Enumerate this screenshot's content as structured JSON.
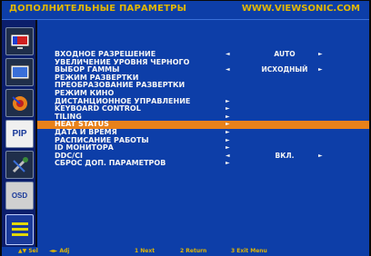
{
  "header": {
    "title": "ДОПОЛНИТЕЛЬНЫЕ ПАРАМЕТРЫ",
    "url": "WWW.VIEWSONIC.COM"
  },
  "sidebar": {
    "icons": [
      "monitor-icon",
      "screen-icon",
      "audio-icon",
      "pip-icon",
      "tools-icon",
      "osd-icon",
      "list-icon"
    ],
    "pip_label": "PIP",
    "osd_label": "OSD"
  },
  "menu": {
    "items": [
      {
        "label": "ВХОДНОЕ РАЗРЕШЕНИЕ",
        "arrow_left": "◄",
        "value": "AUTO",
        "arrow_right": "►"
      },
      {
        "label": "УВЕЛИЧЕНИЕ УРОВНЯ ЧЕРНОГО",
        "arrow_left": "",
        "value": "",
        "arrow_right": ""
      },
      {
        "label": "ВЫБОР ГАММЫ",
        "arrow_left": "◄",
        "value": "ИСХОДНЫЙ",
        "arrow_right": "►"
      },
      {
        "label": "РЕЖИМ РАЗВЕРТКИ",
        "arrow_left": "",
        "value": "",
        "arrow_right": ""
      },
      {
        "label": "ПРЕОБРАЗОВАНИЕ РАЗВЕРТКИ",
        "arrow_left": "",
        "value": "",
        "arrow_right": ""
      },
      {
        "label": "РЕЖИМ КИНО",
        "arrow_left": "",
        "value": "",
        "arrow_right": ""
      },
      {
        "label": "ДИСТАНЦИОННОЕ УПРАВЛЕНИЕ",
        "arrow_left": "►",
        "value": "",
        "arrow_right": ""
      },
      {
        "label": "KEYBOARD CONTROL",
        "arrow_left": "►",
        "value": "",
        "arrow_right": ""
      },
      {
        "label": "TILING",
        "arrow_left": "►",
        "value": "",
        "arrow_right": ""
      },
      {
        "label": "HEAT STATUS",
        "arrow_left": "►",
        "value": "",
        "arrow_right": "",
        "selected": true
      },
      {
        "label": "ДАТА И ВРЕМЯ",
        "arrow_left": "►",
        "value": "",
        "arrow_right": ""
      },
      {
        "label": "РАСПИСАНИЕ РАБОТЫ",
        "arrow_left": "►",
        "value": "",
        "arrow_right": ""
      },
      {
        "label": "ID МОНИТОРА",
        "arrow_left": "►",
        "value": "",
        "arrow_right": ""
      },
      {
        "label": "DDC/CI",
        "arrow_left": "◄",
        "value": "ВКЛ.",
        "arrow_right": "►"
      },
      {
        "label": "СБРОС ДОП. ПАРАМЕТРОВ",
        "arrow_left": "►",
        "value": "",
        "arrow_right": ""
      }
    ]
  },
  "footer": {
    "sel": "▲▼ Sel",
    "adj": "◄► Adj",
    "next": "1 Next",
    "return": "2 Return",
    "exit": "3 Exit Menu"
  },
  "colors": {
    "panel_blue": "#0d3ea8",
    "highlight": "#e8811a",
    "header_text": "#e2b700"
  }
}
